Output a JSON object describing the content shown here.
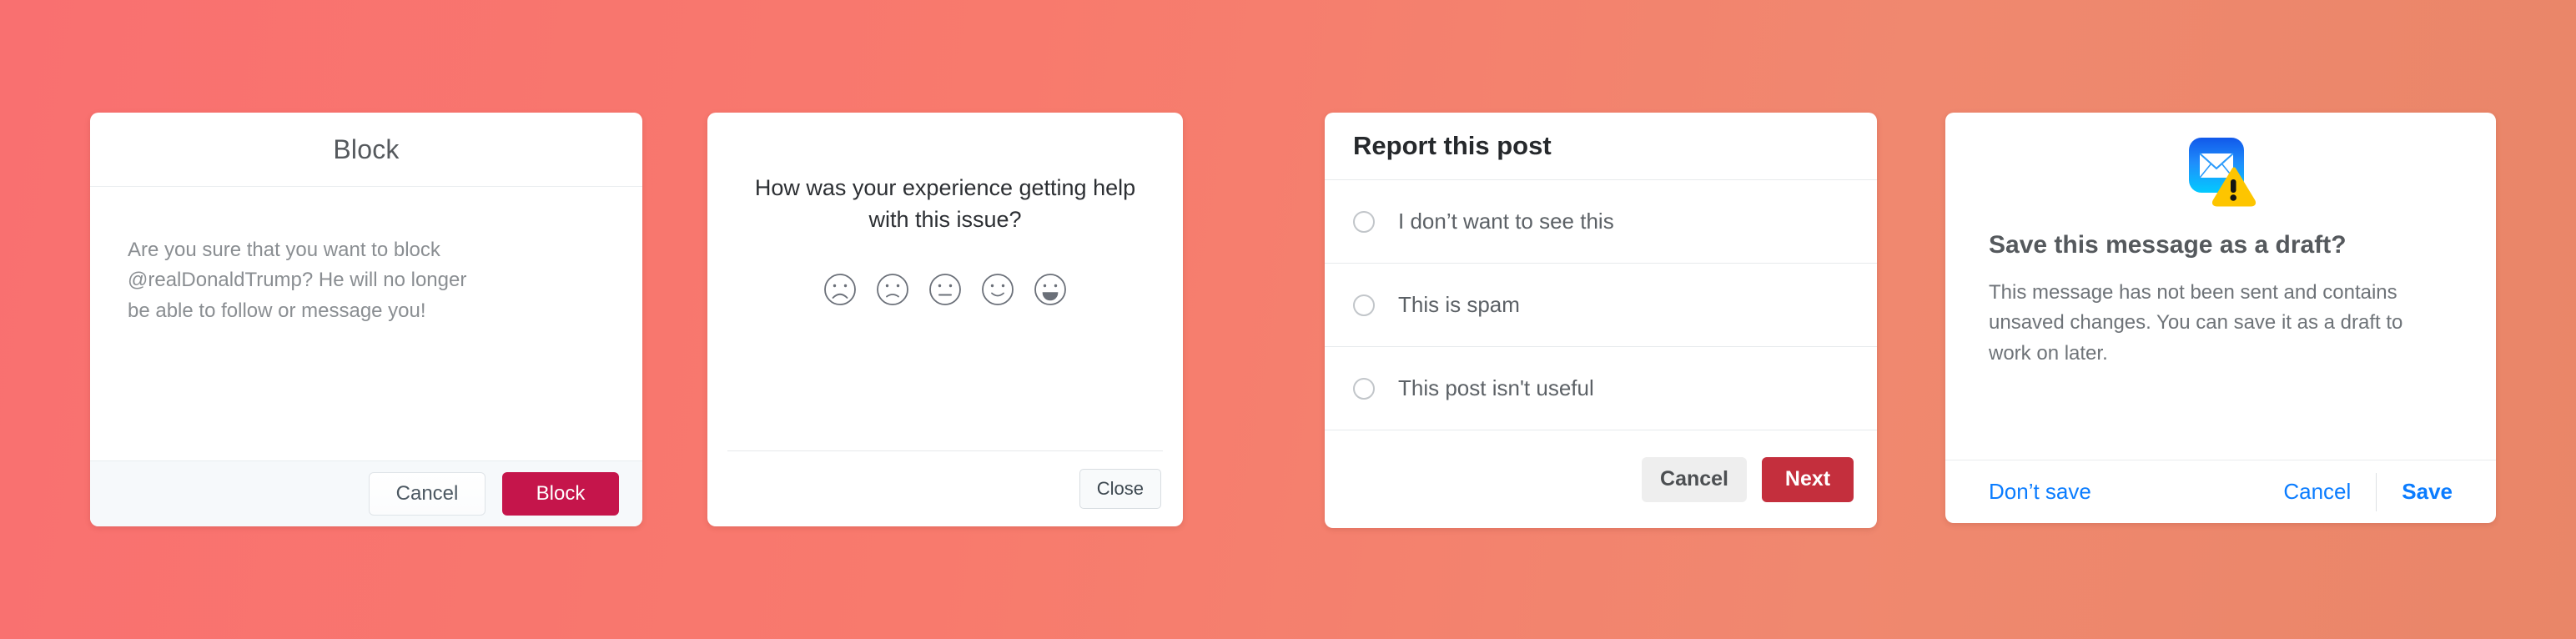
{
  "theme": {
    "background_left": "#f97070",
    "background_right": "#e98668",
    "crimson": "#c5154b",
    "red": "#c42f3d",
    "link_blue": "#0a7cff",
    "warning_yellow": "#fdc500",
    "mail_blue_top": "#1464e6",
    "mail_blue_bottom": "#00c8ff"
  },
  "cards": {
    "block": {
      "title": "Block",
      "body": "Are you sure that you want to block @realDonaldTrump? He will no longer be able to follow or message you!",
      "cancel_label": "Cancel",
      "confirm_label": "Block"
    },
    "rating": {
      "question": "How was your experience getting help with this issue?",
      "faces": [
        {
          "name": "very-sad-face-icon",
          "mood": "very-sad",
          "value": 1
        },
        {
          "name": "sad-face-icon",
          "mood": "sad",
          "value": 2
        },
        {
          "name": "neutral-face-icon",
          "mood": "neutral",
          "value": 3
        },
        {
          "name": "happy-face-icon",
          "mood": "happy",
          "value": 4
        },
        {
          "name": "very-happy-face-icon",
          "mood": "very-happy",
          "value": 5
        }
      ],
      "close_label": "Close"
    },
    "report": {
      "title": "Report this post",
      "options": [
        {
          "label": "I don’t want to see this",
          "selected": false
        },
        {
          "label": "This is spam",
          "selected": false
        },
        {
          "label": "This post isn't useful",
          "selected": false
        }
      ],
      "cancel_label": "Cancel",
      "next_label": "Next"
    },
    "draft": {
      "icon": "mail-warning-icon",
      "heading": "Save this message as a draft?",
      "body": "This message has not been sent and contains unsaved changes. You can save it as a draft to work on later.",
      "dont_save_label": "Don’t save",
      "cancel_label": "Cancel",
      "save_label": "Save"
    }
  }
}
